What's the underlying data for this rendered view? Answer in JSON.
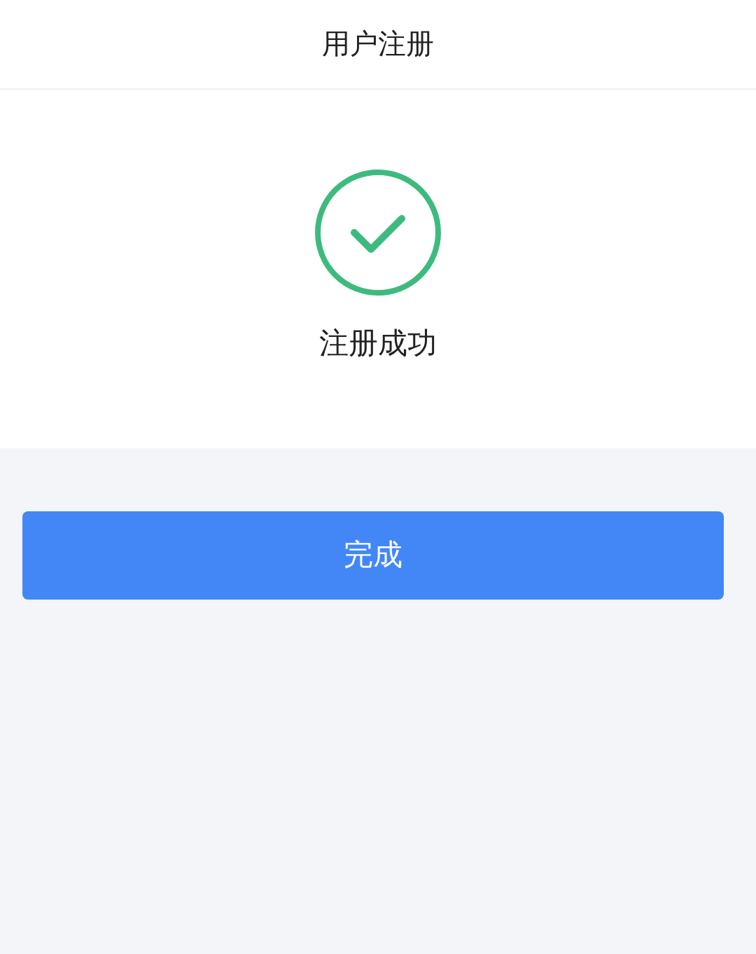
{
  "header": {
    "title": "用户注册"
  },
  "result": {
    "kind": "success",
    "message": "注册成功"
  },
  "buttons": [
    "完成"
  ]
}
